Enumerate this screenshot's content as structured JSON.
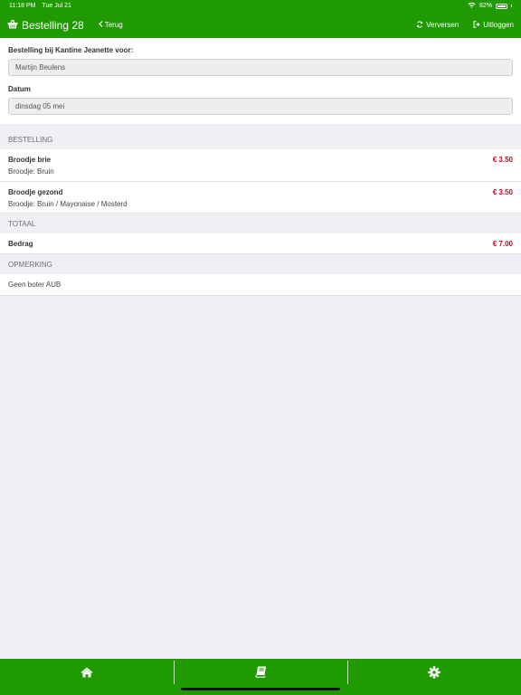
{
  "status_bar": {
    "time": "11:18 PM",
    "date": "Tue Jul 21",
    "battery": "82%"
  },
  "navbar": {
    "title": "Bestelling 28",
    "back_label": "Terug",
    "refresh_label": "Verversen",
    "logout_label": "Uitloggen"
  },
  "form": {
    "order_for_label": "Bestelling bij Kantine Jeanette voor:",
    "order_for_value": "Martijn Beulens",
    "date_label": "Datum",
    "date_value": "dinsdag 05 mei"
  },
  "order": {
    "header": "BESTELLING",
    "items": [
      {
        "name": "Broodje brie",
        "details": "Broodje: Bruin",
        "price": "€ 3.50"
      },
      {
        "name": "Broodje gezond",
        "details": "Broodje: Bruin / Mayonaise / Mosterd",
        "price": "€ 3.50"
      }
    ]
  },
  "total": {
    "header": "TOTAAL",
    "label": "Bedrag",
    "amount": "€ 7.00"
  },
  "remark": {
    "header": "OPMERKING",
    "text": "Geen boter AUB"
  },
  "tabbar": {
    "icons": [
      "home-icon",
      "book-icon",
      "gear-icon"
    ]
  },
  "colors": {
    "brand_green": "#1f9a00",
    "price_red": "#d0021b",
    "background": "#efeff4"
  }
}
